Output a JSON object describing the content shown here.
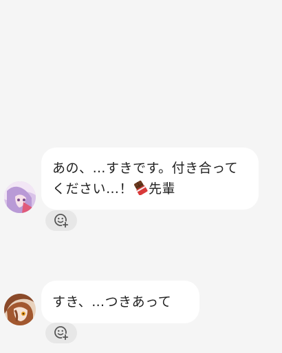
{
  "messages": [
    {
      "lines": [
        "あの、…すきです。付き合って",
        "ください…！"
      ],
      "emoji_icon": "chocolate-bar-emoji",
      "suffix": "先輩",
      "reaction_icon": "add-reaction-icon"
    },
    {
      "lines": [
        "すき、…つきあって"
      ],
      "reaction_icon": "add-reaction-icon"
    }
  ],
  "colors": {
    "background": "#f5f5f5",
    "bubble": "#ffffff",
    "text": "#1f1f1f",
    "reaction_button": "#e7e7e7",
    "icon": "#555555"
  }
}
